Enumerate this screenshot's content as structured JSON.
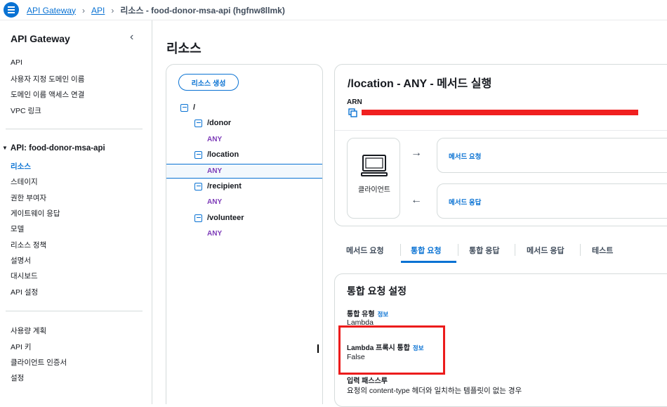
{
  "breadcrumb": {
    "items": [
      "API Gateway",
      "API",
      "리소스 - food-donor-msa-api (hgfnw8llmk)"
    ]
  },
  "sidebar": {
    "title": "API Gateway",
    "top_items": [
      "API",
      "사용자 지정 도메인 이름",
      "도메인 이름 액세스 연결",
      "VPC 링크"
    ],
    "section_title": "API: food-donor-msa-api",
    "section_items": [
      "리소스",
      "스테이지",
      "권한 부여자",
      "게이트웨이 응답",
      "모델",
      "리소스 정책",
      "설명서",
      "대시보드",
      "API 설정"
    ],
    "bottom_items": [
      "사용량 계획",
      "API 키",
      "클라이언트 인증서",
      "설정"
    ]
  },
  "page": {
    "title": "리소스"
  },
  "tree": {
    "create_button": "리소스 생성",
    "root": "/",
    "resources": [
      {
        "path": "/donor",
        "method": "ANY"
      },
      {
        "path": "/location",
        "method": "ANY"
      },
      {
        "path": "/recipient",
        "method": "ANY"
      },
      {
        "path": "/volunteer",
        "method": "ANY"
      }
    ]
  },
  "execution": {
    "title": "/location - ANY - 메서드 실행",
    "arn_label": "ARN",
    "client_label": "클라이언트",
    "method_request": "메서드 요청",
    "method_response": "메서드 응답"
  },
  "tabs": [
    "메서드 요청",
    "통합 요청",
    "통합 응답",
    "메서드 응답",
    "테스트"
  ],
  "settings": {
    "title": "통합 요청 설정",
    "info_label": "정보",
    "integration_type_label": "통합 유형",
    "integration_type_value": "Lambda",
    "proxy_label": "Lambda 프록시 통합",
    "proxy_value": "False",
    "passthrough_label": "입력 패스스루",
    "passthrough_value": "요청의 content-type 헤더와 일치하는 템플릿이 없는 경우"
  },
  "colors": {
    "accent": "#0972d3",
    "method": "#7d3bb8",
    "highlight": "#ec1c1c"
  }
}
